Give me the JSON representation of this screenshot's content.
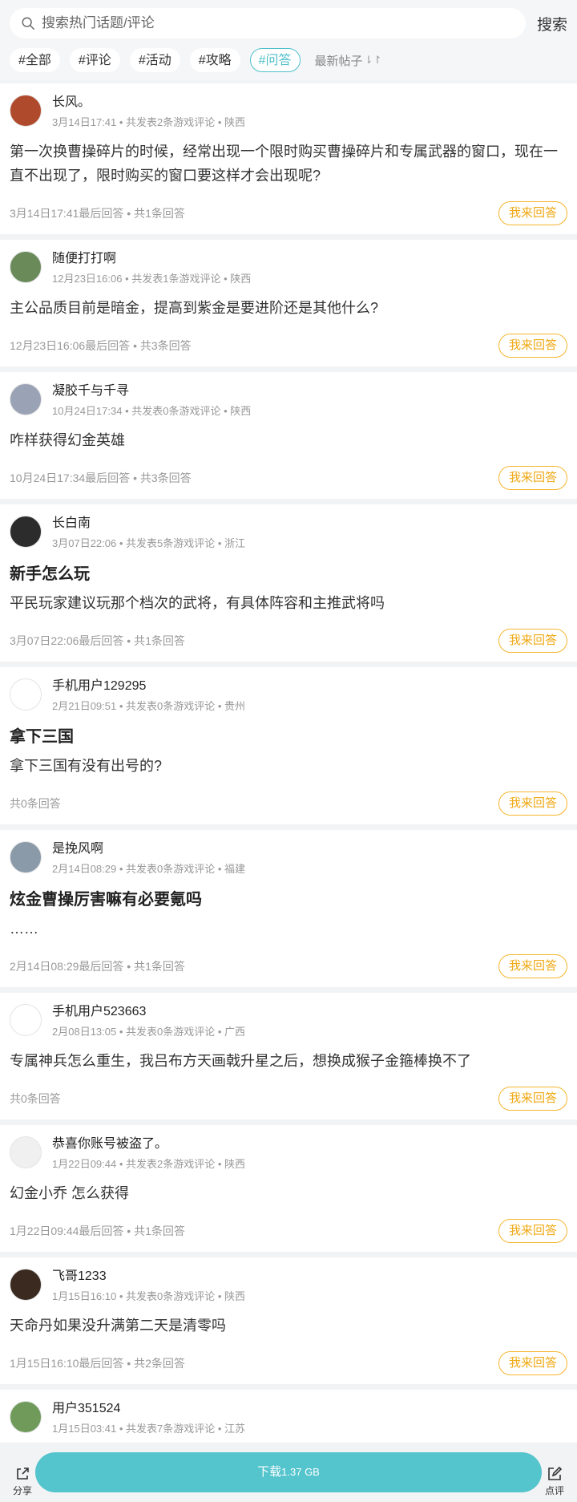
{
  "search": {
    "placeholder": "搜索热门话题/评论",
    "button": "搜索"
  },
  "tags": [
    {
      "label": "#全部",
      "active": false
    },
    {
      "label": "#评论",
      "active": false
    },
    {
      "label": "#活动",
      "active": false
    },
    {
      "label": "#攻略",
      "active": false
    },
    {
      "label": "#问答",
      "active": true
    }
  ],
  "sort": {
    "label": "最新帖子",
    "icon": "sort-arrows-icon"
  },
  "answer_label": "我来回答",
  "posts": [
    {
      "user": "长风。",
      "meta": "3月14日17:41 • 共发表2条游戏评论 • 陕西",
      "title": "",
      "text": "第一次换曹操碎片的时候，经常出现一个限时购买曹操碎片和专属武器的窗口，现在一直不出现了，限时购买的窗口要这样才会出现呢?",
      "footer": "3月14日17:41最后回答 • 共1条回答",
      "avatar_color": "#b04a2c"
    },
    {
      "user": "随便打打啊",
      "meta": "12月23日16:06 • 共发表1条游戏评论 • 陕西",
      "title": "",
      "text": "主公品质目前是暗金，提高到紫金是要进阶还是其他什么?",
      "footer": "12月23日16:06最后回答 • 共3条回答",
      "avatar_color": "#6a8a5a"
    },
    {
      "user": "凝胶千与千寻",
      "meta": "10月24日17:34 • 共发表0条游戏评论 • 陕西",
      "title": "",
      "text": "咋样获得幻金英雄",
      "footer": "10月24日17:34最后回答 • 共3条回答",
      "avatar_color": "#9aa3b5"
    },
    {
      "user": "长白南",
      "meta": "3月07日22:06 • 共发表5条游戏评论 • 浙江",
      "title": "新手怎么玩",
      "text": "平民玩家建议玩那个档次的武将，有具体阵容和主推武将吗",
      "footer": "3月07日22:06最后回答 • 共1条回答",
      "avatar_color": "#2c2c2c"
    },
    {
      "user": "手机用户129295",
      "meta": "2月21日09:51 • 共发表0条游戏评论 • 贵州",
      "title": "拿下三国",
      "text": "拿下三国有没有出号的?",
      "footer": "共0条回答",
      "avatar_color": "#ffffff"
    },
    {
      "user": "是挽风啊",
      "meta": "2月14日08:29 • 共发表0条游戏评论 • 福建",
      "title": "炫金曹操厉害嘛有必要氪吗",
      "text": "……",
      "footer": "2月14日08:29最后回答 • 共1条回答",
      "avatar_color": "#8a9aa8"
    },
    {
      "user": "手机用户523663",
      "meta": "2月08日13:05 • 共发表0条游戏评论 • 广西",
      "title": "",
      "text": "专属神兵怎么重生，我吕布方天画戟升星之后，想换成猴子金箍棒换不了",
      "footer": "共0条回答",
      "avatar_color": "#ffffff"
    },
    {
      "user": "恭喜你账号被盗了。",
      "meta": "1月22日09:44 • 共发表2条游戏评论 • 陕西",
      "title": "",
      "text": "幻金小乔 怎么获得",
      "footer": "1月22日09:44最后回答 • 共1条回答",
      "avatar_color": "#f0f0f0"
    },
    {
      "user": "飞哥1233",
      "meta": "1月15日16:10 • 共发表0条游戏评论 • 陕西",
      "title": "",
      "text": "天命丹如果没升满第二天是清零吗",
      "footer": "1月15日16:10最后回答 • 共2条回答",
      "avatar_color": "#3a2a20"
    },
    {
      "user": "用户351524",
      "meta": "1月15日03:41 • 共发表7条游戏评论 • 江苏",
      "title": "",
      "text": "",
      "footer": "",
      "avatar_color": "#6f9a5a"
    }
  ],
  "bottom": {
    "share": "分享",
    "download": "下载",
    "size": "1.37 GB",
    "rate": "点评"
  }
}
